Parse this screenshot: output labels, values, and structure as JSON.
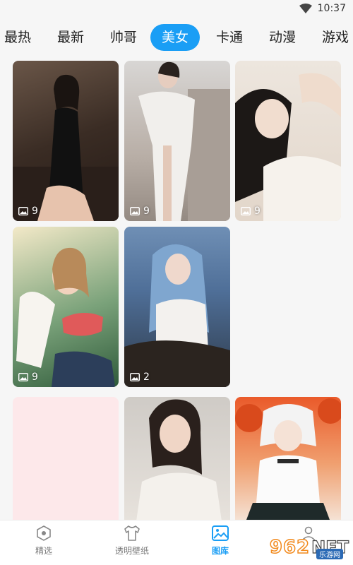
{
  "status_bar": {
    "time": "10:37"
  },
  "tabs": [
    {
      "label": "最热",
      "active": false
    },
    {
      "label": "最新",
      "active": false
    },
    {
      "label": "帅哥",
      "active": false
    },
    {
      "label": "美女",
      "active": true
    },
    {
      "label": "卡通",
      "active": false
    },
    {
      "label": "动漫",
      "active": false
    },
    {
      "label": "游戏",
      "active": false
    }
  ],
  "albums": [
    {
      "count": "9",
      "theme": "black-qipao"
    },
    {
      "count": "9",
      "theme": "white-dress"
    },
    {
      "count": "9",
      "theme": "lying-portrait"
    },
    {
      "count": "9",
      "theme": "summer-bikini"
    },
    {
      "count": "2",
      "theme": "blue-hair-horse"
    },
    {
      "count": "",
      "theme": "blank-pink"
    },
    {
      "count": "",
      "theme": "white-sweater"
    },
    {
      "count": "",
      "theme": "anime-girl"
    }
  ],
  "bottom_nav": [
    {
      "label": "精选",
      "icon": "hexagon-star-icon",
      "active": false
    },
    {
      "label": "透明壁纸",
      "icon": "tshirt-icon",
      "active": false
    },
    {
      "label": "图库",
      "icon": "gallery-icon",
      "active": true
    },
    {
      "label": "",
      "icon": "user-icon",
      "active": false
    }
  ],
  "watermark": {
    "number": "962",
    "suffix": "NET",
    "caption": "乐游网"
  },
  "colors": {
    "accent": "#1a9ef5",
    "background": "#f6f6f6"
  }
}
